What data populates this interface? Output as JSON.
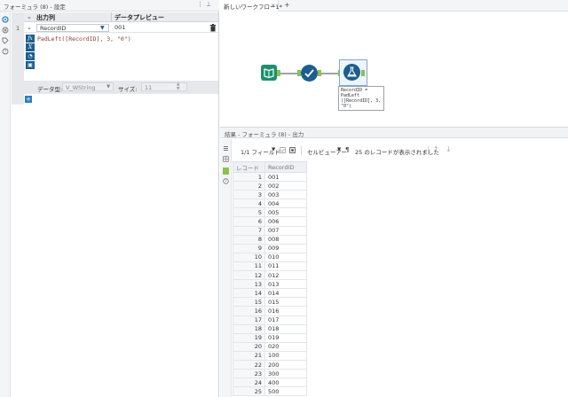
{
  "config_panel": {
    "title": "フォーミュラ (8) - 設定",
    "header": {
      "col_output": "出力列",
      "col_preview": "データプレビュー"
    },
    "row": {
      "index": "1",
      "field": "RecordID",
      "preview": "001"
    },
    "expression": "PadLeft([RecordID], 3, \"0\")",
    "tool_buttons": [
      "fx",
      "X",
      "save",
      "disk"
    ],
    "type_label": "データ型:",
    "type_value": "V_WString",
    "size_label": "サイズ:",
    "size_value": "11",
    "add_label": "+"
  },
  "canvas": {
    "tab_label": "新しいワークフロー1*",
    "new_tab": "+",
    "annotation": [
      "RecordID =",
      "PadLeft",
      "([RecordID], 3,",
      "\"0\")"
    ],
    "colors": {
      "input": "#1e8f6e",
      "recordid": "#1b5e8f",
      "formula": "#1b5e8f",
      "connector": "#8ac249"
    }
  },
  "results": {
    "title": "結果 - フォーミュラ (8) - 出力",
    "fields_label": "1/1 フィールド",
    "cell_viewer_label": "セルビューアー",
    "record_count_text": "25 のレコードが表示されました",
    "columns": [
      "レコード",
      "RecordID"
    ],
    "rows": [
      [
        "1",
        "001"
      ],
      [
        "2",
        "002"
      ],
      [
        "3",
        "003"
      ],
      [
        "4",
        "004"
      ],
      [
        "5",
        "005"
      ],
      [
        "6",
        "006"
      ],
      [
        "7",
        "007"
      ],
      [
        "8",
        "008"
      ],
      [
        "9",
        "009"
      ],
      [
        "10",
        "010"
      ],
      [
        "11",
        "011"
      ],
      [
        "12",
        "012"
      ],
      [
        "13",
        "013"
      ],
      [
        "14",
        "014"
      ],
      [
        "15",
        "015"
      ],
      [
        "16",
        "016"
      ],
      [
        "17",
        "017"
      ],
      [
        "18",
        "018"
      ],
      [
        "19",
        "019"
      ],
      [
        "20",
        "020"
      ],
      [
        "21",
        "100"
      ],
      [
        "22",
        "200"
      ],
      [
        "23",
        "300"
      ],
      [
        "24",
        "400"
      ],
      [
        "25",
        "500"
      ]
    ]
  }
}
